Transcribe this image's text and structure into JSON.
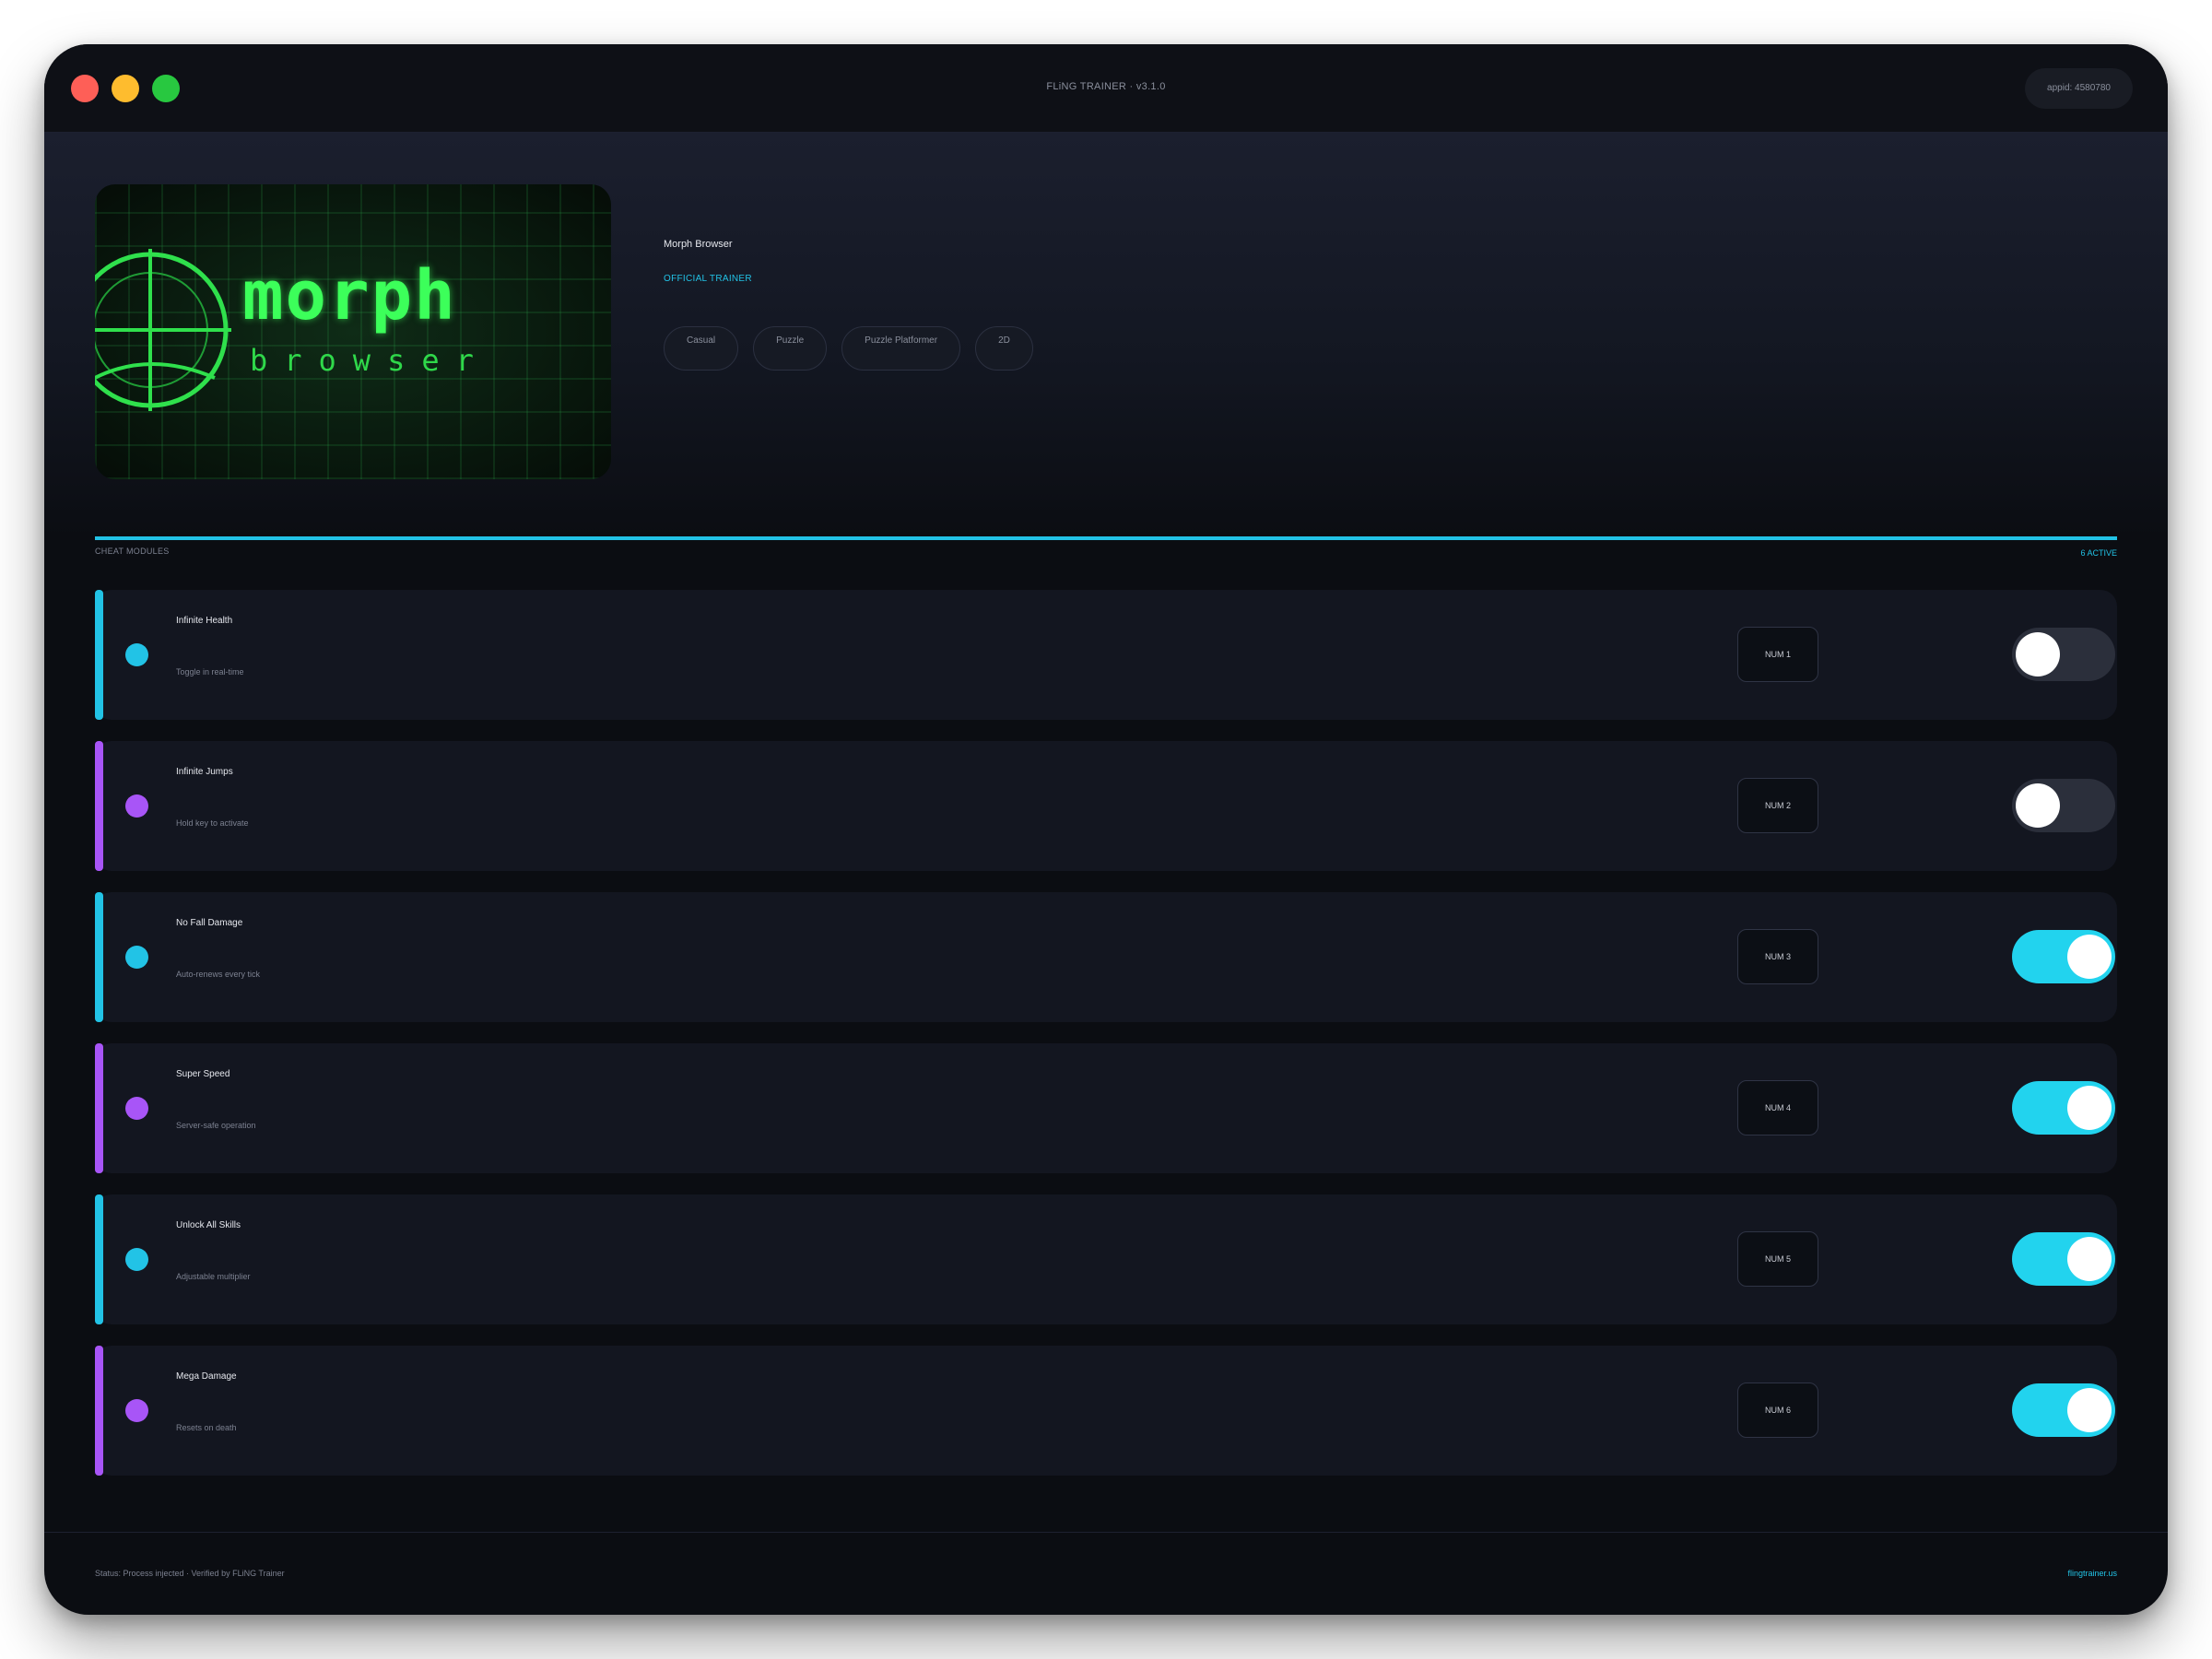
{
  "window": {
    "title": "FLiNG TRAINER · v3.1.0",
    "appid": "appid: 4580780"
  },
  "game": {
    "cover_word": "morph",
    "cover_sub": "browser",
    "title": "Morph Browser",
    "badge": "OFFICIAL TRAINER",
    "tags": [
      "Casual",
      "Puzzle",
      "Puzzle Platformer",
      "2D"
    ]
  },
  "section": {
    "label": "CHEAT MODULES",
    "active": "6 ACTIVE"
  },
  "colors": {
    "cyan": "#22c3e6",
    "purple": "#a855f7",
    "toggle_on": "#22d3ee"
  },
  "cheats": [
    {
      "name": "Infinite Health",
      "desc": "Toggle in real-time",
      "key": "NUM 1",
      "enabled": false,
      "accent": "cyan"
    },
    {
      "name": "Infinite Jumps",
      "desc": "Hold key to activate",
      "key": "NUM 2",
      "enabled": false,
      "accent": "purple"
    },
    {
      "name": "No Fall Damage",
      "desc": "Auto-renews every tick",
      "key": "NUM 3",
      "enabled": true,
      "accent": "cyan"
    },
    {
      "name": "Super Speed",
      "desc": "Server-safe operation",
      "key": "NUM 4",
      "enabled": true,
      "accent": "purple"
    },
    {
      "name": "Unlock All Skills",
      "desc": "Adjustable multiplier",
      "key": "NUM 5",
      "enabled": true,
      "accent": "cyan"
    },
    {
      "name": "Mega Damage",
      "desc": "Resets on death",
      "key": "NUM 6",
      "enabled": true,
      "accent": "purple"
    }
  ],
  "footer": {
    "status": "Status: Process injected · Verified by FLiNG Trainer",
    "link": "flingtrainer.us"
  }
}
